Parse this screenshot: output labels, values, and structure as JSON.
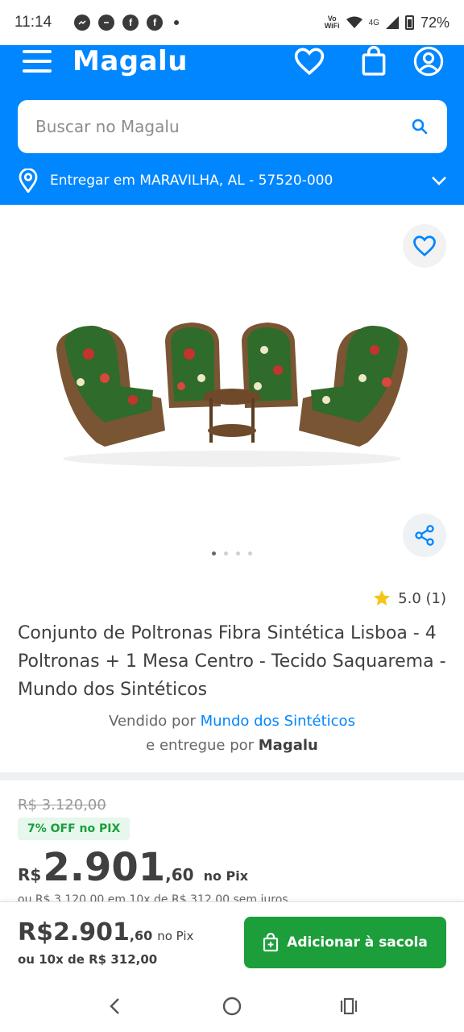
{
  "status_bar": {
    "time": "11:14",
    "network": "4G",
    "vowifi_top": "Vo",
    "vowifi_bottom": "WiFi",
    "battery": "72%",
    "notif_icons": [
      "messenger-icon",
      "chat-bubble-icon",
      "facebook-icon",
      "facebook-icon"
    ]
  },
  "header": {
    "logo": "Magalu",
    "brand_color": "#0086ff",
    "search_placeholder": "Buscar no Magalu",
    "delivery_text": "Entregar em MARAVILHA, AL - 57520-000"
  },
  "gallery": {
    "image_count": 4,
    "active_index": 0
  },
  "product": {
    "rating": "5.0 (1)",
    "title": "Conjunto de Poltronas Fibra Sintética Lisboa - 4 Poltronas + 1 Mesa Centro - Tecido Saquarema - Mundo dos Sintéticos",
    "sold_by_prefix": "Vendido por ",
    "seller_name": "Mundo dos Sintéticos",
    "delivered_by_prefix": "e entregue por ",
    "delivered_by": "Magalu"
  },
  "price": {
    "old_price": "R$ 3.120,00",
    "off_badge": "7% OFF no PIX",
    "currency": "R$",
    "integer": "2.901",
    "decimal": ",60",
    "pix_label": "no Pix",
    "installment_cut": "ou R$ 3.120,00 em 10x de R$ 312,00 sem juros"
  },
  "buy_bar": {
    "price_integer": "R$2.901",
    "price_decimal": ",60",
    "pix_label": "no Pix",
    "installment": "ou 10x de R$ 312,00",
    "add_button": "Adicionar à sacola",
    "button_color": "#1c9e3a"
  }
}
